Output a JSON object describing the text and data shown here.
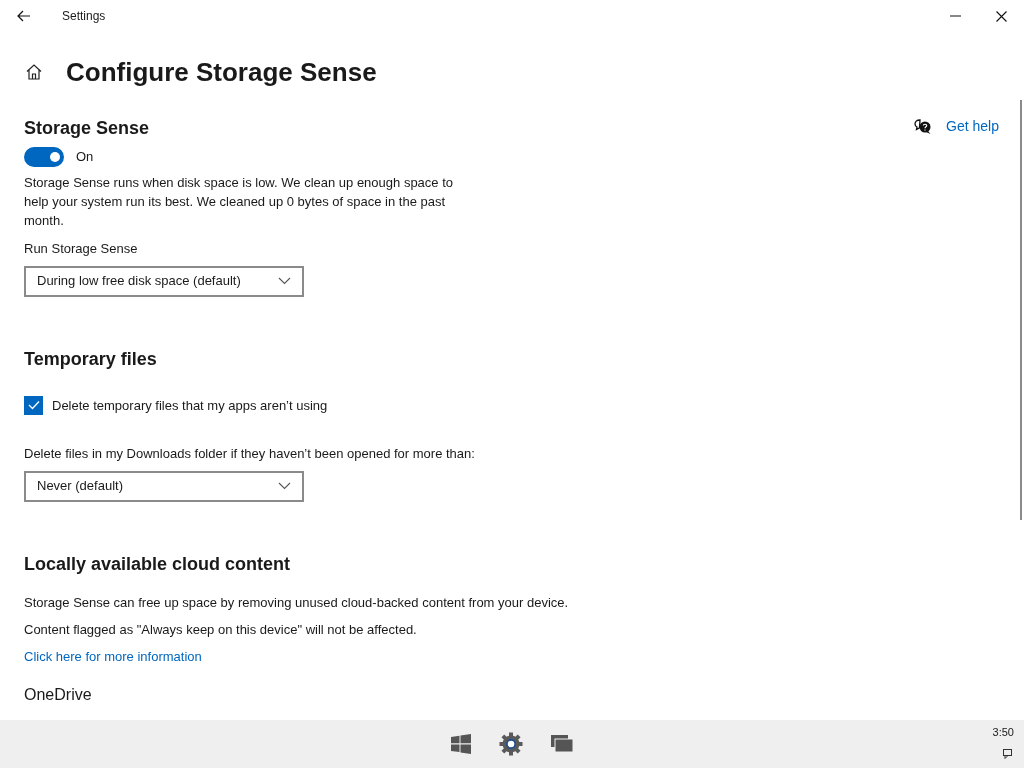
{
  "window": {
    "title": "Settings"
  },
  "page_title": "Configure Storage Sense",
  "help": {
    "label": "Get help"
  },
  "storage_sense": {
    "heading": "Storage Sense",
    "toggle": {
      "on": true,
      "label": "On"
    },
    "description": "Storage Sense runs when disk space is low. We clean up enough space to help your system run its best. We cleaned up 0 bytes of space in the past month.",
    "run_label": "Run Storage Sense",
    "run_value": "During low free disk space (default)"
  },
  "temporary_files": {
    "heading": "Temporary files",
    "checkbox": {
      "label": "Delete temporary files that my apps aren’t using",
      "checked": true
    },
    "downloads_label": "Delete files in my Downloads folder if they haven’t been opened for more than:",
    "downloads_value": "Never (default)"
  },
  "cloud": {
    "heading": "Locally available cloud content",
    "lines": [
      "Storage Sense can free up space by removing unused cloud-backed content from your device.",
      "Content flagged as \"Always keep on this device\" will not be affected."
    ],
    "link": "Click here for more information",
    "next_heading": "OneDrive"
  },
  "taskbar": {
    "time": "3:50"
  }
}
